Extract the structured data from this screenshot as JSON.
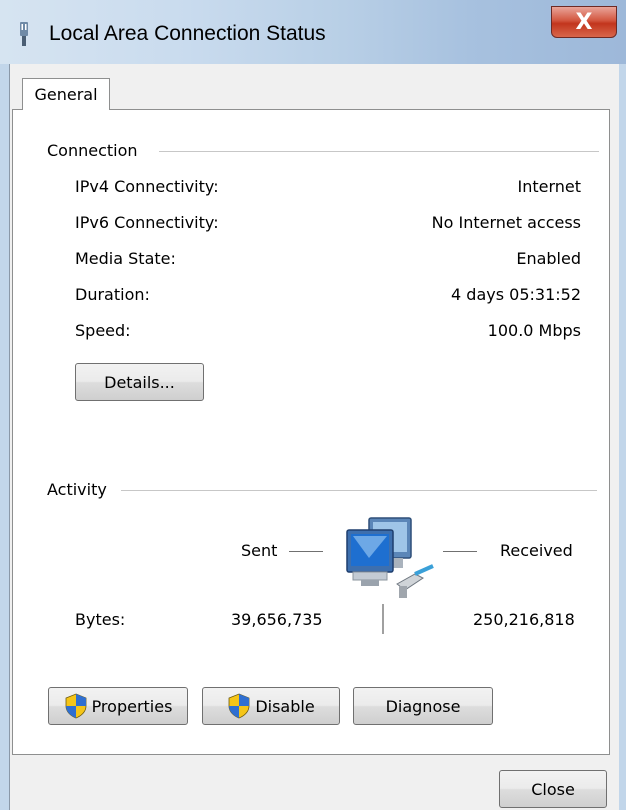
{
  "window": {
    "title": "Local Area Connection Status",
    "close_glyph": "X"
  },
  "tabs": [
    {
      "label": "General"
    }
  ],
  "connection": {
    "heading": "Connection",
    "rows": [
      {
        "label": "IPv4 Connectivity:",
        "value": "Internet"
      },
      {
        "label": "IPv6 Connectivity:",
        "value": "No Internet access"
      },
      {
        "label": "Media State:",
        "value": "Enabled"
      },
      {
        "label": "Duration:",
        "value": "4 days 05:31:52"
      },
      {
        "label": "Speed:",
        "value": "100.0 Mbps"
      }
    ],
    "details_button": "Details..."
  },
  "activity": {
    "heading": "Activity",
    "sent_label": "Sent",
    "received_label": "Received",
    "bytes_label": "Bytes:",
    "bytes_sent": "39,656,735",
    "bytes_received": "250,216,818"
  },
  "buttons": {
    "properties": "Properties",
    "disable": "Disable",
    "diagnose": "Diagnose",
    "close": "Close"
  },
  "icons": {
    "titlebar": "network-plug-icon",
    "network": "network-computers-icon",
    "shield": "uac-shield-icon"
  }
}
